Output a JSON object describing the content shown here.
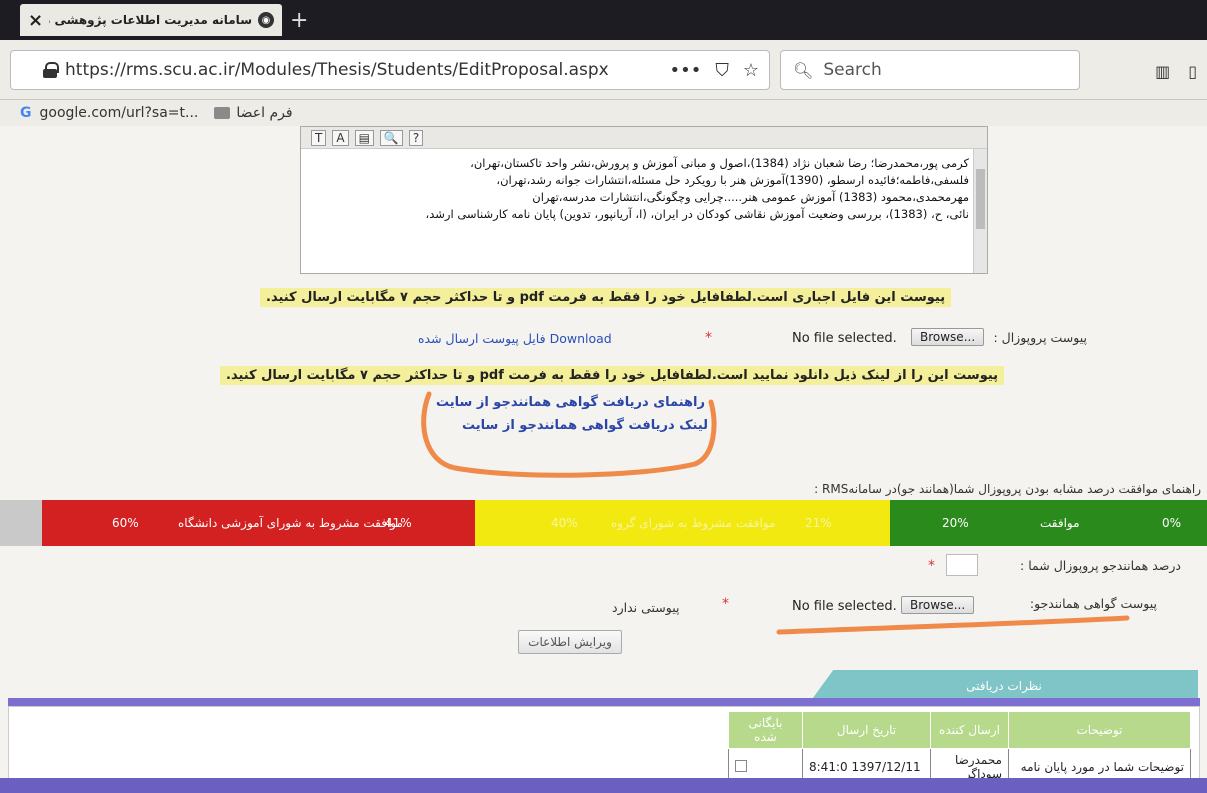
{
  "browser": {
    "tab_title": "سامانه مدیریت اطلاعات پژوهشی دا...",
    "url": "https://rms.scu.ac.ir/Modules/Thesis/Students/EditProposal.aspx",
    "url_actions": [
      "•••",
      "⛉",
      "☆"
    ],
    "search_placeholder": "Search",
    "bookmarks": [
      {
        "label": "google.com/url?sa=t..."
      },
      {
        "label": "فرم اعضا"
      }
    ]
  },
  "editor": {
    "toolbar": [
      "T",
      "A",
      "▤",
      "🔍",
      "?"
    ],
    "lines": [
      "كرمی پور،محمدرضا؛ رضا شعبان نژاد (1384)،اصول و مبانی آموزش و پرورش،نشر واحد تاكستان،تهران،",
      "فلسفی،فاطمه؛فائیده ارسطو، (1390)آموزش هنر با رویكرد حل مسئله،انتشارات جوانه رشد،تهران،",
      "مهرمحمدی،محمود (1383) آموزش عمومی هنر.....چرایی وچگونگی،انتشارات مدرسه،تهران",
      "نائی، ح، (1383)، بررسی وضعیت آموزش نقاشی كودكان در ایران، (ا، آریانپور، تدوین) پایان نامه كارشناسی ارشد،"
    ]
  },
  "notice1": "پیوست این فایل اجباری است.لطفافایل خود را فقط به فرمت pdf و تا حداکثر حجم ۷ مگابایت ارسال کنید.",
  "proposal_attachment": {
    "label": "پیوست پروپوزال :",
    "browse": "Browse...",
    "file_status": "No file selected.",
    "required": "*",
    "download": "Download",
    "download_desc": "فایل پیوست ارسال شده"
  },
  "notice2": "پیوست این را از لینک ذیل دانلود نمایید است.لطفافایل خود را فقط به فرمت pdf و تا حداکثر حجم ۷ مگابایت ارسال کنید.",
  "links": {
    "guide": "راهنمای دریافت گواهی همانندجو از سایت",
    "link": "لینک دریافت گواهی همانندجو از سایت"
  },
  "rms_guide_label": "راهنمای موافقت درصد مشابه بودن پروپوزال شما(همانند جو)در سامانهRMS :",
  "similarity_bar": {
    "segments": [
      {
        "color": "#2b8a1c",
        "labels": [
          "0%",
          "موافقت",
          "20%"
        ]
      },
      {
        "color": "#f1e90f",
        "labels": [
          "21%",
          "موافقت مشروط به شورای گروه",
          "40%"
        ]
      },
      {
        "color": "#d32020",
        "labels": [
          "41%",
          "موافقت مشروط به شورای آموزشی دانشگاه",
          "60%"
        ]
      }
    ]
  },
  "similarity_field": {
    "label": "درصد همانندجو پروپوزال شما :",
    "required": "*"
  },
  "certificate_attachment": {
    "label": "پیوست گواهی همانندجو:",
    "browse": "Browse...",
    "file_status": "No file selected.",
    "required": "*",
    "no_attachment": "پیوستی ندارد"
  },
  "edit_button": "ویرایش اطلاعات",
  "comments": {
    "tab_label": "نظرات دریافتی",
    "columns": [
      "توضیحات",
      "ارسال کننده",
      "تاریخ ارسال",
      "بایگانی شده"
    ],
    "rows": [
      {
        "description": "توضیحات شما در مورد پایان نامه",
        "sender": "محمدرضا سوداگر",
        "date": "8:41:0 1397/12/11"
      }
    ]
  },
  "colors": {
    "accent_purple": "#7d6fd1",
    "notice_highlight": "#f3ef9a",
    "tab_teal": "#7fc4c6",
    "scribble": "#f08a4b"
  }
}
